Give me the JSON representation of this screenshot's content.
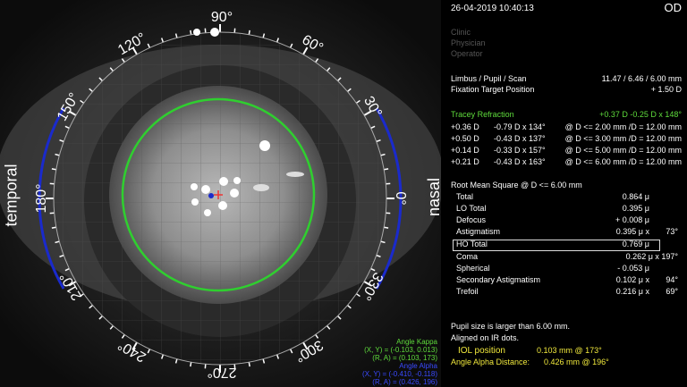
{
  "header": {
    "datetime": "26-04-2019   10:40:13",
    "eye": "OD"
  },
  "info": {
    "clinic": "Clinic",
    "physician": "Physician",
    "operator": "Operator",
    "lps_label": "Limbus / Pupil / Scan",
    "lps_value": "11.47 / 6.46 / 6.00 mm",
    "fix_label": "Fixation Target Position",
    "fix_value": "+ 1.50 D"
  },
  "tracey": {
    "label": "Tracey Refraction",
    "value": "+0.37 D -0.25 D x 148°",
    "rows": [
      {
        "sph": "+0.36 D",
        "cyl": "-0.79 D x 134°",
        "at": "@ D <= 2.00 mm /D = 12.00 mm"
      },
      {
        "sph": "+0.50 D",
        "cyl": "-0.43 D x 137°",
        "at": "@ D <= 3.00 mm /D = 12.00 mm"
      },
      {
        "sph": "+0.14 D",
        "cyl": "-0.33 D x 157°",
        "at": "@ D <= 5.00 mm /D = 12.00 mm"
      },
      {
        "sph": "+0.21 D",
        "cyl": "-0.43 D x 163°",
        "at": "@ D <= 6.00 mm /D = 12.00 mm"
      }
    ]
  },
  "rms": {
    "title": "Root Mean Square @ D <= 6.00 mm",
    "rows": [
      {
        "label": "Total",
        "value": "0.864 μ",
        "angle": ""
      },
      {
        "label": "LO Total",
        "value": "0.395 μ",
        "angle": ""
      },
      {
        "label": "Defocus",
        "value": "+ 0.008 μ",
        "angle": ""
      },
      {
        "label": "Astigmatism",
        "value": "0.395 μ x",
        "angle": "73°"
      },
      {
        "label": "HO Total",
        "value": "0.769 μ",
        "angle": ""
      },
      {
        "label": "Coma",
        "value": "0.262 μ x 197°",
        "angle": ""
      },
      {
        "label": "Spherical",
        "value": "- 0.053 μ",
        "angle": ""
      },
      {
        "label": "Secondary Astigmatism",
        "value": "0.102 μ x",
        "angle": "94°"
      },
      {
        "label": "Trefoil",
        "value": "0.216 μ x",
        "angle": "69°"
      }
    ]
  },
  "footer": {
    "pupil_note": "Pupil size is larger than 6.00 mm.",
    "aligned_note": "Aligned on IR dots.",
    "iol_label": "IOL position",
    "iol_value": "0.103 mm @ 173°",
    "alpha_label": "Angle Alpha Distance:",
    "alpha_value": "0.426 mm @ 196°"
  },
  "eye_image": {
    "side_left": "temporal",
    "side_right": "nasal",
    "degree_labels": [
      "90°",
      "60°",
      "30°",
      "0°",
      "330°",
      "300°",
      "270°",
      "240°",
      "210°",
      "180°",
      "150°",
      "120°"
    ],
    "kappa_title": "Angle Kappa",
    "kappa_xy": "(X, Y) = (-0.103, 0.013)",
    "kappa_ra": "(R, A) = (0.103, 173)",
    "alpha_title": "Angle Alpha",
    "alpha_xy": "(X, Y) = (-0.410, -0.118)",
    "alpha_ra": "(R, A) = (0.426, 196)",
    "colors": {
      "limbus_ring": "#2fcf2f",
      "arc_blue": "#1a2acc",
      "kappa_text": "#5fdc3c",
      "alpha_text": "#3a4aff"
    }
  }
}
